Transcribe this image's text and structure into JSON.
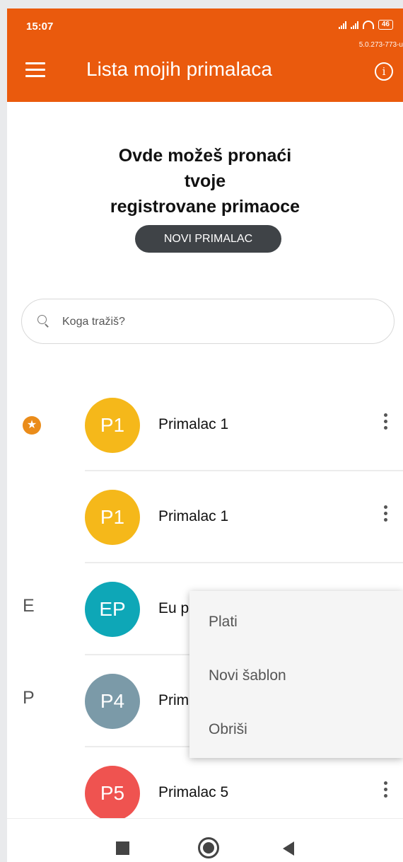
{
  "status_bar": {
    "time": "15:07",
    "battery": "46",
    "version": "5.0.273-773-u"
  },
  "app_bar": {
    "title": "Lista mojih primalaca",
    "menu_icon": "hamburger-menu-icon",
    "info_icon": "info-icon"
  },
  "main": {
    "headline_line1": "Ovde možeš pronaći",
    "headline_line2": "tvoje",
    "headline_line3": "registrovane primaoce",
    "new_recipient_button": "NOVI PRIMALAC"
  },
  "search": {
    "placeholder": "Koga tražiš?",
    "value": ""
  },
  "recipients": [
    {
      "group": "",
      "favorite": true,
      "initials": "P1",
      "name": "Primalac 1",
      "color": "#f5b81a"
    },
    {
      "group": "",
      "favorite": false,
      "initials": "P1",
      "name": "Primalac 1",
      "color": "#f5b81a"
    },
    {
      "group": "E",
      "favorite": false,
      "initials": "EP",
      "name": "Eu primalac",
      "color": "#0ea7b7"
    },
    {
      "group": "P",
      "favorite": false,
      "initials": "P4",
      "name": "Primalac 4",
      "color": "#7b9aa8"
    },
    {
      "group": "",
      "favorite": false,
      "initials": "P5",
      "name": "Primalac 5",
      "color": "#ef5350"
    }
  ],
  "context_menu": {
    "pay": "Plati",
    "new_template": "Novi šablon",
    "delete": "Obriši"
  },
  "colors": {
    "accent": "#ea5a0d",
    "button_dark": "#3f4347",
    "favorite": "#ea8c1a"
  }
}
